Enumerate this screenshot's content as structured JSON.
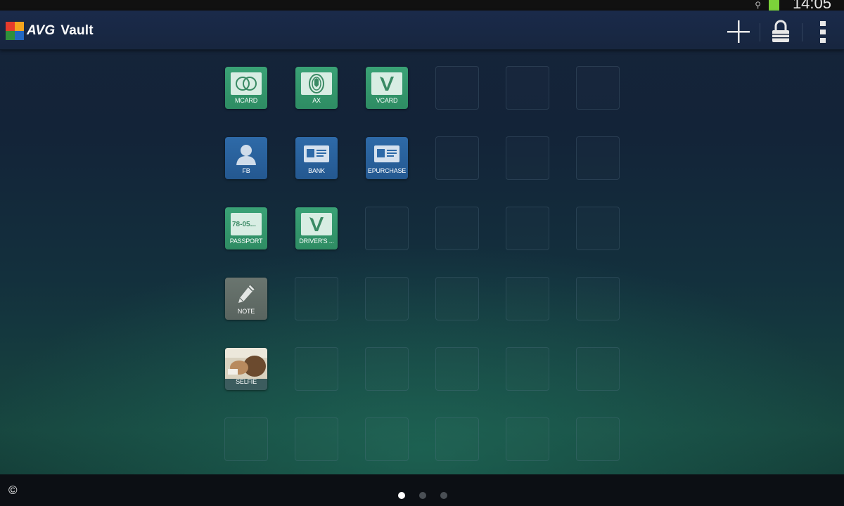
{
  "status_bar": {
    "usb_icon": "usb-icon",
    "battery_color": "#7cd33a",
    "time": "14:05"
  },
  "action_bar": {
    "brand": "AVG",
    "title": "Vault",
    "actions": [
      {
        "icon": "plus-icon"
      },
      {
        "icon": "lock-icon"
      },
      {
        "icon": "overflow-menu-icon"
      }
    ]
  },
  "vault": {
    "items": [
      {
        "label": "MCARD",
        "icon": "mastercard-icon",
        "color": "green"
      },
      {
        "label": "AX",
        "icon": "amex-card-icon",
        "color": "green"
      },
      {
        "label": "VCARD",
        "icon": "visa-card-icon",
        "color": "green"
      },
      {
        "label": "FB",
        "icon": "person-icon",
        "color": "blue"
      },
      {
        "label": "BANK",
        "icon": "id-card-icon",
        "color": "blue"
      },
      {
        "label": "EPURCHASE",
        "icon": "id-card-icon",
        "color": "blue"
      },
      {
        "label": "PASSPORT",
        "icon": "passport-icon",
        "card_text": "78-05...",
        "color": "green"
      },
      {
        "label": "DRIVER'S ...",
        "icon": "visa-card-icon",
        "color": "green"
      },
      {
        "label": "NOTE",
        "icon": "pencil-icon",
        "color": "gray"
      },
      {
        "label": "SELFIE",
        "icon": "photo-thumbnail",
        "color": "photo"
      }
    ]
  },
  "bottom_bar": {
    "copyright": "©",
    "pages": 3,
    "active_page": 1
  }
}
